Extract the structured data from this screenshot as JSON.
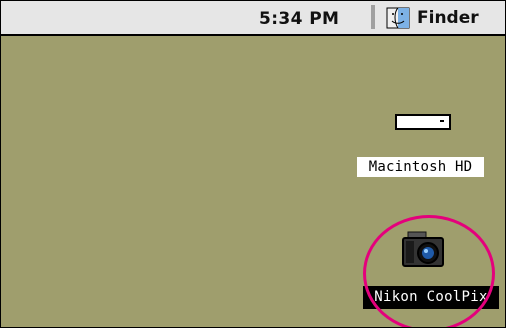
{
  "menubar": {
    "clock_text": "5:34 PM",
    "app_icon": "finder-icon",
    "app_label": "Finder"
  },
  "desktop": {
    "background_color": "#9f9e6d",
    "items": [
      {
        "label": "Macintosh HD",
        "icon": "hard-drive-icon"
      },
      {
        "label": "Nikon CoolPix",
        "icon": "camera-icon",
        "selected": true
      }
    ]
  },
  "annotation": {
    "type": "highlight-circle",
    "color": "#e4007c"
  }
}
